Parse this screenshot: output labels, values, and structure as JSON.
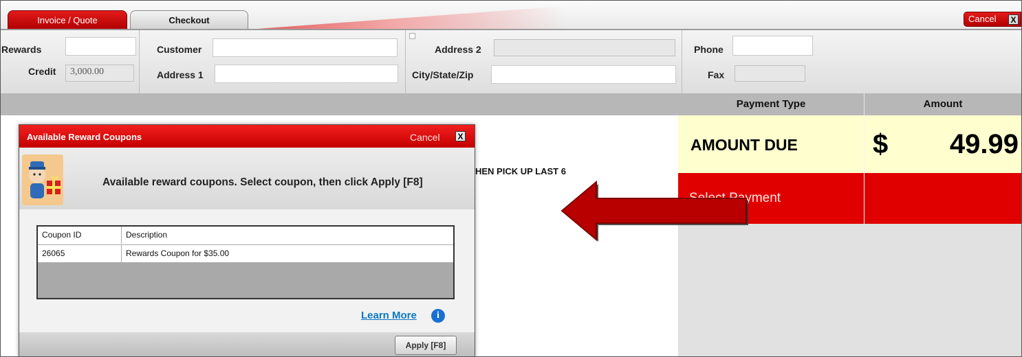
{
  "tabs": {
    "invoice": "Invoice / Quote",
    "checkout": "Checkout",
    "cancel": "Cancel",
    "close": "X"
  },
  "fields": {
    "rewards": {
      "label": "Rewards",
      "value": ""
    },
    "credit": {
      "label": "Credit",
      "value": "3,000.00"
    },
    "customer": {
      "label": "Customer",
      "value": ""
    },
    "address1": {
      "label": "Address 1",
      "value": ""
    },
    "address2": {
      "label": "Address 2",
      "value": ""
    },
    "city": {
      "label": "City/State/Zip",
      "value": ""
    },
    "phone": {
      "label": "Phone",
      "value": ""
    },
    "fax": {
      "label": "Fax",
      "value": ""
    }
  },
  "payment": {
    "col_type": "Payment Type",
    "col_amount": "Amount",
    "amount_due_label": "AMOUNT DUE",
    "currency": "$",
    "amount_due_value": "49.99",
    "select_payment": "Select Payment"
  },
  "background_text": "HEN PICK UP LAST 6",
  "modal": {
    "title": "Available Reward Coupons",
    "cancel": "Cancel",
    "close": "X",
    "instructions": "Available reward coupons. Select coupon, then click Apply [F8]",
    "table": {
      "headers": [
        "Coupon ID",
        "Description"
      ],
      "rows": [
        {
          "id": "26065",
          "description": "Rewards Coupon for $35.00"
        }
      ]
    },
    "learn_more": "Learn More",
    "info_glyph": "i",
    "apply": "Apply [F8]"
  },
  "colors": {
    "brand_red": "#e10000",
    "amount_due_bg": "#fefecf",
    "arrow": "#b80000"
  }
}
